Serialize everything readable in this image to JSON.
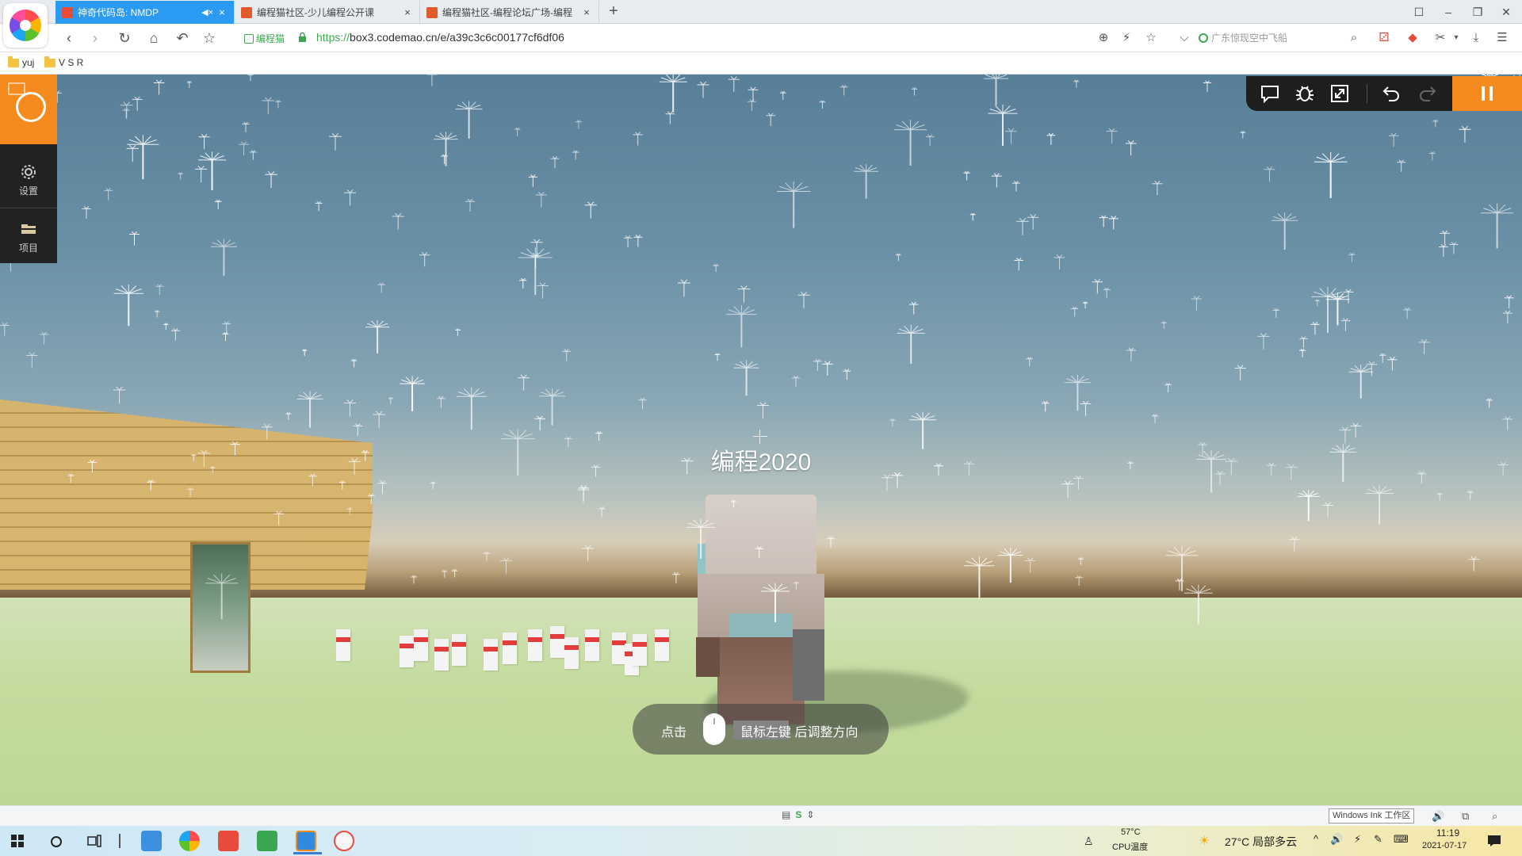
{
  "browser": {
    "tabs": [
      {
        "label": "神奇代码岛: NMDP",
        "active": true,
        "muted_icon": "speaker-mute-icon",
        "close": "×"
      },
      {
        "label": "编程猫社区-少儿编程公开课",
        "active": false,
        "close": "×"
      },
      {
        "label": "编程猫社区-编程论坛广场-编程",
        "active": false,
        "close": "×"
      }
    ],
    "new_tab": "+",
    "window_controls": [
      "☐",
      "–",
      "❐",
      "✕"
    ],
    "nav": {
      "back": "‹",
      "forward": "›",
      "reload": "↻",
      "home": "⌂",
      "undo": "↶",
      "favorite": "☆"
    },
    "site_badge": "编程猫",
    "url_proto": "https://",
    "url_rest": "box3.codemao.cn/e/a39c3c6c00177cf6df06",
    "search_placeholder": "广东惊现空中飞船",
    "toolbar_glyphs": [
      "⊕",
      "⚡",
      "☆",
      "⌵",
      "⌕",
      "⚂",
      "✂",
      "▾",
      "⤓",
      "☰"
    ]
  },
  "bookmarks": [
    {
      "label": "yuj"
    },
    {
      "label": "V S R"
    }
  ],
  "game": {
    "player_name": "编程2020",
    "hint": {
      "prefix": "点击",
      "suffix": "鼠标左键 后调整方向"
    },
    "side_items": [
      {
        "label": "设置",
        "icon": "gear-icon"
      },
      {
        "label": "项目",
        "icon": "project-icon"
      }
    ],
    "toolbar": [
      "chat-icon",
      "bug-icon",
      "fullscreen-icon",
      "undo-icon",
      "redo-icon",
      "pause-icon"
    ]
  },
  "statusbar": {
    "windows_ink": "Windows Ink 工作区",
    "icons": [
      "▤",
      "S",
      "⇕"
    ],
    "right_icons": [
      "🔊",
      "⧉",
      "⌕"
    ]
  },
  "taskbar": {
    "cpu_temp": "57°C",
    "cpu_label": "CPU温度",
    "weather": "27°C  局部多云",
    "time": "11:19",
    "date": "2021-07-17",
    "tray_glyphs": [
      "^",
      "🔊",
      "⚡",
      "✎",
      "⌨"
    ]
  },
  "colors": {
    "accent_orange": "#f58a1f",
    "tab_active": "#2b9af3",
    "safe_green": "#3aa852"
  }
}
